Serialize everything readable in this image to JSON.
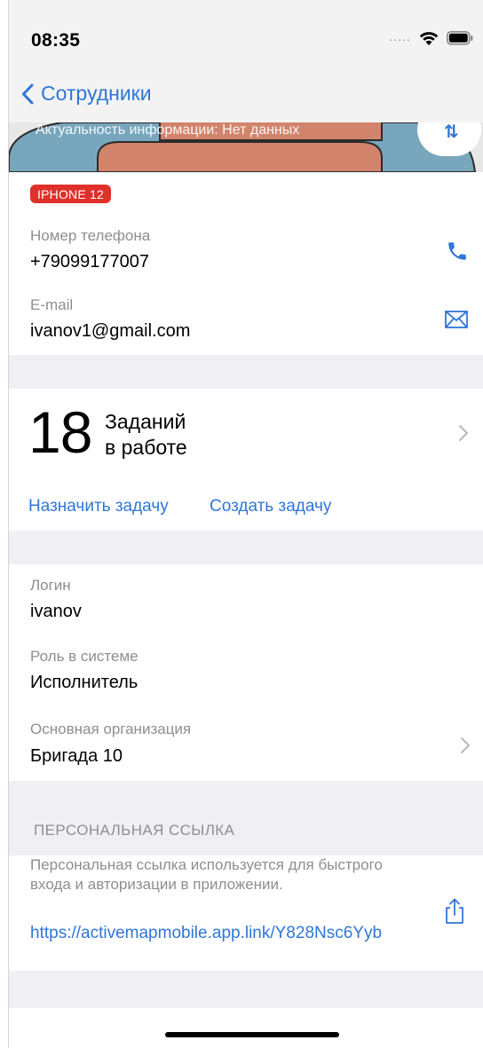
{
  "status_bar": {
    "time": "08:35",
    "signal_dots": "....."
  },
  "nav": {
    "back_label": "Сотрудники"
  },
  "hero": {
    "caption": "Актуальность информации: Нет данных",
    "badge_glyph": "⇅"
  },
  "device_tag": "IPHONE 12",
  "contacts": {
    "phone_label": "Номер телефона",
    "phone_value": "+79099177007",
    "email_label": "E-mail",
    "email_value": "ivanov1@gmail.com"
  },
  "tasks": {
    "count": "18",
    "line1": "Заданий",
    "line2": "в работе",
    "assign_label": "Назначить задачу",
    "create_label": "Создать задачу"
  },
  "account": {
    "login_label": "Логин",
    "login_value": "ivanov",
    "role_label": "Роль в системе",
    "role_value": "Исполнитель",
    "org_label": "Основная организация",
    "org_value": "Бригада 10"
  },
  "personal_link": {
    "header": "ПЕРСОНАЛЬНАЯ ССЫЛКА",
    "description": "Персональная ссылка используется для быстрого входа и авторизации в приложении.",
    "url": "https://activemapmobile.app.link/Y828Nsc6Yyb"
  },
  "colors": {
    "accent": "#2f76d8",
    "tag_red": "#e0302a",
    "separator": "#efeff4",
    "secondary_text": "#8e8e93"
  }
}
